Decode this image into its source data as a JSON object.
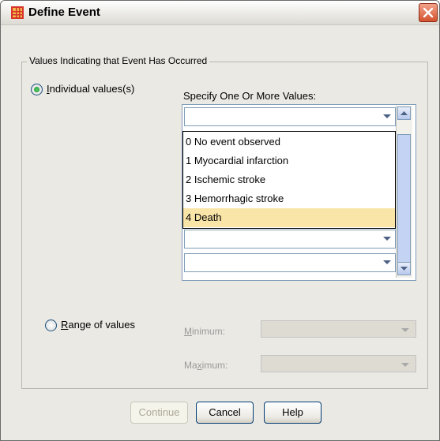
{
  "window": {
    "title": "Define Event"
  },
  "group": {
    "legend": "Values Indicating that Event Has Occurred"
  },
  "individual": {
    "label_u": "I",
    "label_rest": "ndividual values(s)",
    "selected": true
  },
  "specify": {
    "label": "Specify One Or More Values:",
    "input_value": ""
  },
  "options": [
    "0 No event observed",
    "1 Myocardial infarction",
    "2 Ischemic stroke",
    "3 Hemorrhagic stroke",
    "4 Death"
  ],
  "selected_option": "4 Death",
  "range": {
    "label_u": "R",
    "label_rest": "ange of values",
    "selected": false
  },
  "minimum": {
    "label_u": "M",
    "label_rest": "inimum:",
    "value": ""
  },
  "maximum": {
    "label_pre": "Ma",
    "label_u": "x",
    "label_rest": "imum:",
    "value": ""
  },
  "buttons": {
    "continue": "Continue",
    "cancel": "Cancel",
    "help": "Help"
  },
  "colors": {
    "selection": "#fae5a8",
    "title_close": "#d3522f",
    "radio_selected": "#1f8a2b"
  }
}
